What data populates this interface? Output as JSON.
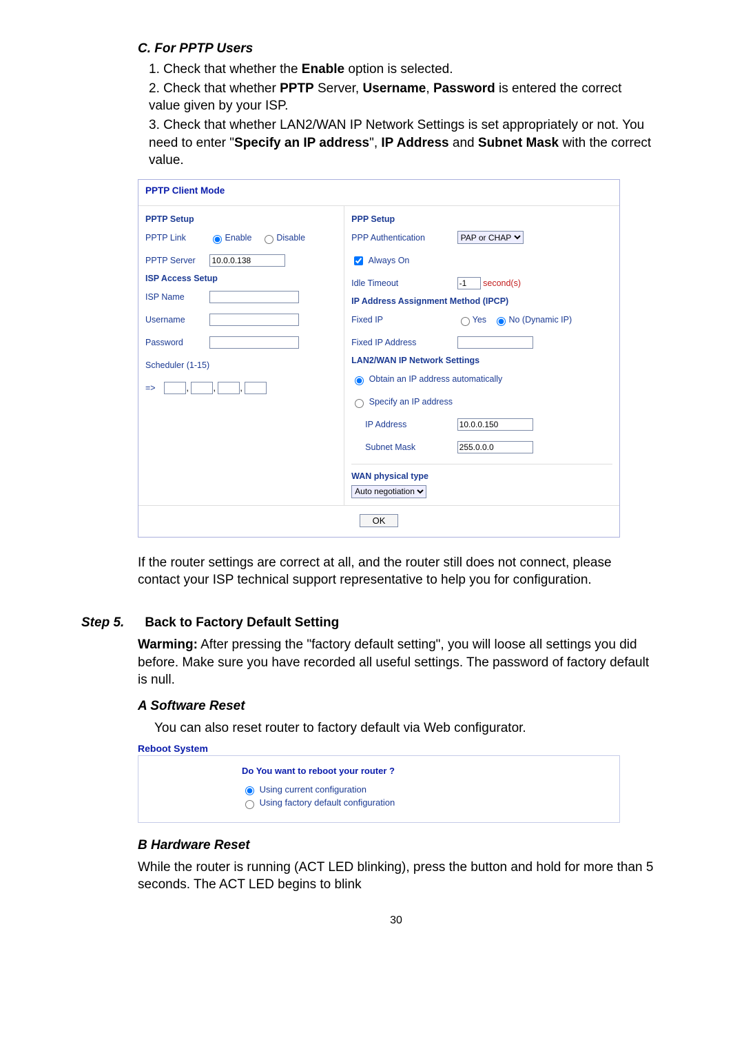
{
  "headings": {
    "c": "C. For PPTP Users",
    "a_reset": "A Software Reset",
    "b_reset": "B Hardware Reset"
  },
  "list_c": {
    "i1_a": "1. Check that whether the ",
    "i1_b": "Enable",
    "i1_c": " option is selected.",
    "i2_a": "2. Check that whether ",
    "i2_b": "PPTP",
    "i2_c": " Server, ",
    "i2_d": "Username",
    "i2_e": ", ",
    "i2_f": "Password",
    "i2_g": " is entered the correct value given by your ISP.",
    "i3_a": "3. Check that whether LAN2/WAN IP Network Settings is set appropriately or not. You need to enter \"",
    "i3_b": "Specify an IP address",
    "i3_c": "\", ",
    "i3_d": "IP Address",
    "i3_e": " and ",
    "i3_f": "Subnet Mask",
    "i3_g": " with the correct value."
  },
  "pptp": {
    "title": "PPTP Client Mode",
    "left": {
      "setup": "PPTP Setup",
      "link": "PPTP Link",
      "enable": "Enable",
      "disable": "Disable",
      "server": "PPTP Server",
      "server_val": "10.0.0.138",
      "access": "ISP Access Setup",
      "ispname": "ISP Name",
      "username": "Username",
      "password": "Password",
      "scheduler": "Scheduler (1-15)",
      "arrow": "=>"
    },
    "right": {
      "ppp": "PPP Setup",
      "auth": "PPP Authentication",
      "auth_val": "PAP or CHAP",
      "always": "Always On",
      "idle": "Idle Timeout",
      "idle_val": "-1",
      "seconds": "second(s)",
      "ipcp": "IP Address Assignment Method (IPCP)",
      "fixedip": "Fixed IP",
      "yes": "Yes",
      "no": "No (Dynamic IP)",
      "fixedaddr": "Fixed IP Address",
      "lan2": "LAN2/WAN IP Network Settings",
      "obtain": "Obtain an IP address automatically",
      "specify": "Specify an IP address",
      "ipaddr": "IP Address",
      "ipaddr_val": "10.0.0.150",
      "mask": "Subnet Mask",
      "mask_val": "255.0.0.0",
      "wan": "WAN physical type",
      "auto": "Auto negotiation"
    },
    "ok": "OK"
  },
  "after_panel": "If the router settings are correct at all, and the router still does not connect, please contact your ISP technical support representative to help you for configuration.",
  "step5": {
    "label": "Step 5.",
    "title": "Back to Factory Default Setting",
    "warn_a": "Warming:",
    "warn_b": " After pressing the \"factory default setting\", you will loose all settings you did before. Make sure you have recorded all useful settings. The password of factory default is null.",
    "asoft_text": "You can also reset router to factory default via Web configurator."
  },
  "reboot": {
    "title": "Reboot System",
    "q": "Do You want to reboot your router ?",
    "opt1": "Using current configuration",
    "opt2": "Using factory default configuration"
  },
  "b_reset_text": "While the router is running (ACT LED blinking), press the button and hold for more than 5 seconds. The ACT LED begins to blink",
  "page_num": "30"
}
